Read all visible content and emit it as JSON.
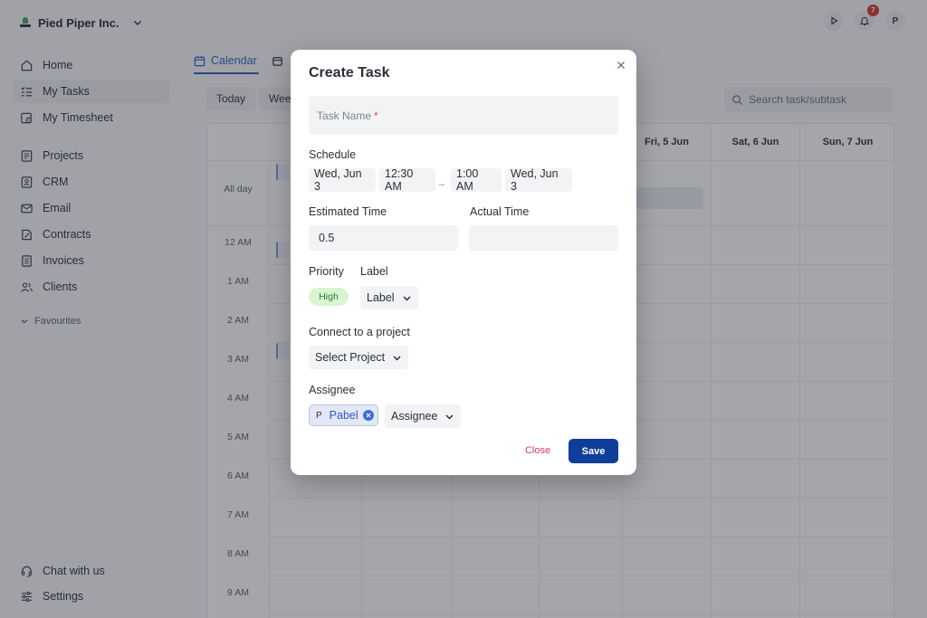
{
  "org": {
    "name": "Pied Piper Inc."
  },
  "sidebar": {
    "items": [
      {
        "label": "Home",
        "icon": "home-icon"
      },
      {
        "label": "My Tasks",
        "icon": "tasks-icon"
      },
      {
        "label": "My Timesheet",
        "icon": "timesheet-icon"
      },
      {
        "label": "Projects",
        "icon": "projects-icon"
      },
      {
        "label": "CRM",
        "icon": "crm-icon"
      },
      {
        "label": "Email",
        "icon": "email-icon"
      },
      {
        "label": "Contracts",
        "icon": "contracts-icon"
      },
      {
        "label": "Invoices",
        "icon": "invoices-icon"
      },
      {
        "label": "Clients",
        "icon": "clients-icon"
      }
    ],
    "favourites_label": "Favourites",
    "bottom": [
      {
        "label": "Chat with us",
        "icon": "headset-icon"
      },
      {
        "label": "Settings",
        "icon": "sliders-icon"
      }
    ]
  },
  "topbar": {
    "notification_count": "7",
    "avatar_initial": "P"
  },
  "calendar": {
    "tab_label": "Calendar",
    "toolbar": {
      "today": "Today",
      "week": "Week"
    },
    "search_placeholder": "Search task/subtask",
    "days": [
      "Fri, 5 Jun",
      "Sat, 6 Jun",
      "Sun, 7 Jun"
    ],
    "all_day": "All day",
    "hours": [
      "12 AM",
      "1 AM",
      "2 AM",
      "3 AM",
      "4 AM",
      "5 AM",
      "6 AM",
      "7 AM",
      "8 AM",
      "9 AM"
    ]
  },
  "modal": {
    "title": "Create Task",
    "task_name_placeholder": "Task Name",
    "required_mark": "*",
    "schedule_label": "Schedule",
    "start_date": "Wed, Jun 3",
    "start_time": "12:30 AM",
    "separator": "–",
    "end_time": "1:00 AM",
    "end_date": "Wed, Jun 3",
    "estimated_label": "Estimated Time",
    "estimated_value": "0.5",
    "actual_label": "Actual Time",
    "actual_value": "",
    "priority_label": "Priority",
    "priority_value": "High",
    "label_label": "Label",
    "label_dropdown": "Label",
    "project_label": "Connect to a project",
    "project_dropdown": "Select Project",
    "assignee_label": "Assignee",
    "assignee_initial": "P",
    "assignee_name": "Pabel",
    "assignee_dropdown": "Assignee",
    "close": "Close",
    "save": "Save"
  },
  "colors": {
    "accent": "#2b5ec9",
    "save_button": "#0e3e9a",
    "priority_high_bg": "#d8f5d2",
    "close_text": "#d23a6e",
    "badge": "#d8322f"
  }
}
